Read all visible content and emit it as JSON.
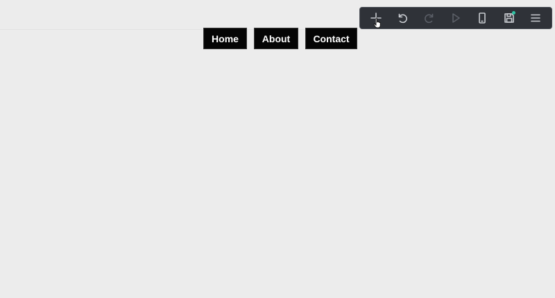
{
  "nav": {
    "home_label": "Home",
    "about_label": "About",
    "contact_label": "Contact"
  },
  "toolbar": {
    "buttons": [
      {
        "icon": "plus-icon",
        "state": "active"
      },
      {
        "icon": "undo-icon",
        "state": "active"
      },
      {
        "icon": "redo-icon",
        "state": "disabled"
      },
      {
        "icon": "play-icon",
        "state": "disabled"
      },
      {
        "icon": "mobile-device-icon",
        "state": "active"
      },
      {
        "icon": "save-icon",
        "state": "active",
        "indicator": "unsaved-changes"
      },
      {
        "icon": "menu-icon",
        "state": "active"
      }
    ]
  },
  "colors": {
    "canvas_background": "#ececec",
    "toolbar_background": "#2f3238",
    "nav_button_background": "#050505",
    "nav_button_text": "#ffffff",
    "save_indicator": "#2fc4a4"
  }
}
